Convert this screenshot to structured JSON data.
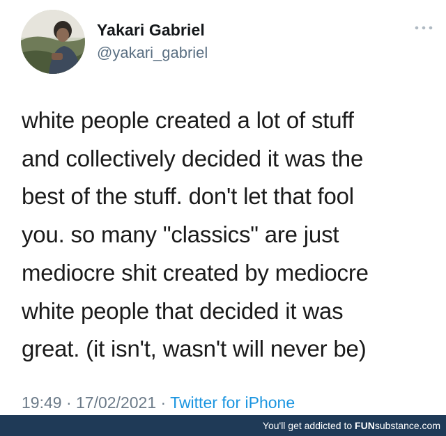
{
  "tweet": {
    "author": {
      "display_name": "Yakari Gabriel",
      "handle": "@yakari_gabriel"
    },
    "text_lines": [
      "white people created a lot of stuff",
      "and collectively decided it was the",
      "best of the stuff. don't let that fool",
      "you. so many \"classics\" are just",
      "mediocre shit created by mediocre",
      "white people that decided it was",
      "great. (it isn't, wasn't will never be)"
    ],
    "time": "19:49",
    "date": "17/02/2021",
    "separator": "·",
    "source": "Twitter for iPhone"
  },
  "watermark": {
    "prefix": "You'll get addicted to ",
    "brand_part1": "FUN",
    "brand_part2": "substance",
    "brand_suffix": ".com"
  },
  "colors": {
    "source_link": "#1b95e0",
    "meta_text": "#6b7a88",
    "footer_bg": "#1f3a57"
  },
  "icons": {
    "more": "more-horizontal-icon"
  }
}
